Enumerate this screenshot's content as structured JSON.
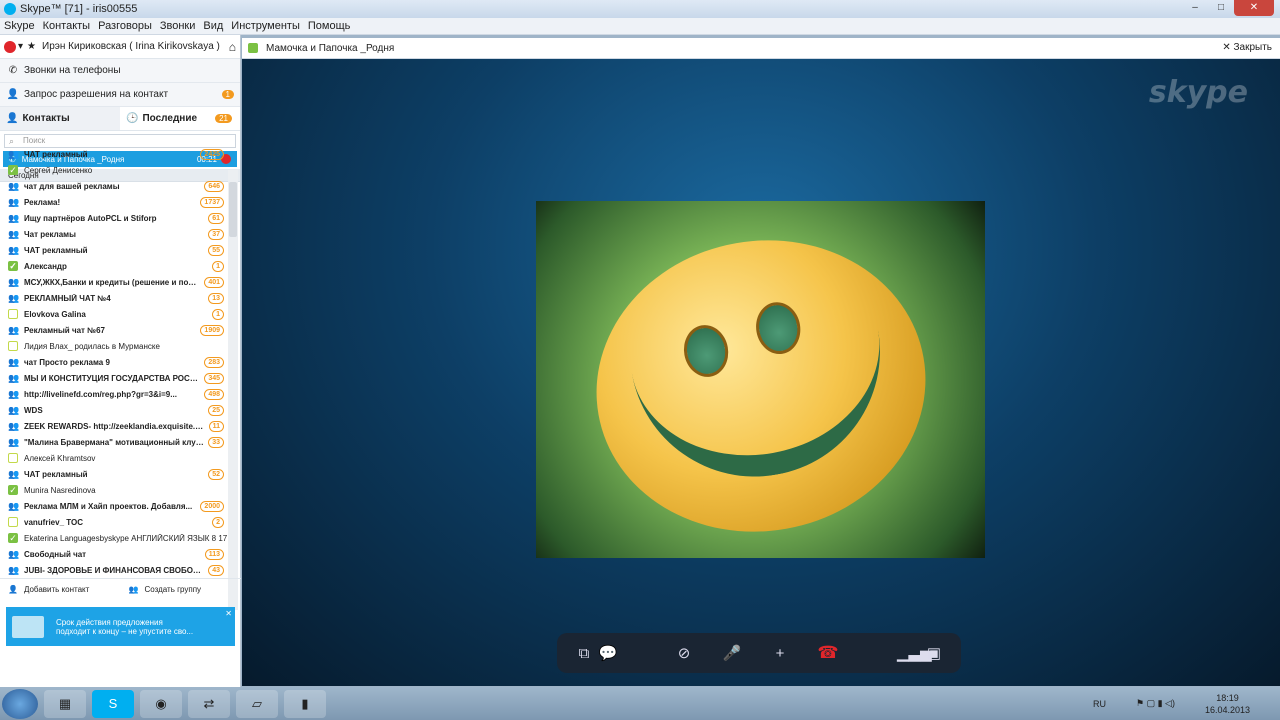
{
  "window": {
    "title": "Skype™ [71] - iris00555",
    "controls": [
      "–",
      "□",
      "✕"
    ]
  },
  "menu": [
    "Skype",
    "Контакты",
    "Разговоры",
    "Звонки",
    "Вид",
    "Инструменты",
    "Помощь"
  ],
  "profile": {
    "name": "Ирэн  Кириковская ( Irina Kirikovskaya )"
  },
  "phone_calls": {
    "label": "Звонки на телефоны"
  },
  "auth_request": {
    "label": "Запрос разрешения на контакт",
    "badge": "1"
  },
  "tabs": {
    "contacts": "Контакты",
    "recent": "Последние",
    "recent_badge": "21"
  },
  "search": {
    "placeholder": "Поиск"
  },
  "active_call": {
    "name": "Мамочка и Папочка _Родня",
    "time": "00:21"
  },
  "group_label": "Сегодня",
  "list": [
    {
      "name": "ЧАТ рекламный",
      "count": "2425",
      "type": "group",
      "bold": true
    },
    {
      "name": "Сергей Денисенко",
      "count": "",
      "type": "online",
      "bold": false
    },
    {
      "name": "чат для вашей рекламы",
      "count": "646",
      "type": "group",
      "bold": true
    },
    {
      "name": "Реклама!",
      "count": "1737",
      "type": "group",
      "bold": true
    },
    {
      "name": "Ищу партнёров AutoPCL и Stiforp",
      "count": "61",
      "type": "group",
      "bold": true
    },
    {
      "name": "Чат рекламы",
      "count": "37",
      "type": "group",
      "bold": true
    },
    {
      "name": "ЧАТ рекламный",
      "count": "55",
      "type": "group",
      "bold": true
    },
    {
      "name": "Александр",
      "count": "1",
      "type": "online",
      "bold": true
    },
    {
      "name": "МСУ,ЖКХ,Банки и кредиты (решение и пом...",
      "count": "401",
      "type": "group",
      "bold": true
    },
    {
      "name": "РЕКЛАМНЫЙ ЧАТ №4",
      "count": "13",
      "type": "group",
      "bold": true
    },
    {
      "name": "Elovkova  Galina",
      "count": "1",
      "type": "offline",
      "bold": true
    },
    {
      "name": "Рекламный чат №67",
      "count": "1909",
      "type": "group",
      "bold": true
    },
    {
      "name": "Лидия Влах_ родилась в Мурманске",
      "count": "",
      "type": "offline",
      "bold": false
    },
    {
      "name": "чат Просто реклама 9",
      "count": "283",
      "type": "group",
      "bold": true
    },
    {
      "name": "МЫ И КОНСТИТУЦИЯ ГОСУДАРСТВА РОССИ...",
      "count": "345",
      "type": "group",
      "bold": true
    },
    {
      "name": "http://livelinefd.com/reg.php?gr=3&i=9...",
      "count": "498",
      "type": "group",
      "bold": true
    },
    {
      "name": "WDS",
      "count": "25",
      "type": "group",
      "bold": true
    },
    {
      "name": "ZEEK REWARDS- http://zeeklandia.exquisite.c...",
      "count": "11",
      "type": "group",
      "bold": true
    },
    {
      "name": "\"Малина Бравермана\" мотивационный клуб...",
      "count": "33",
      "type": "group",
      "bold": true
    },
    {
      "name": "Алексей  Khramtsov",
      "count": "",
      "type": "offline",
      "bold": false
    },
    {
      "name": "ЧАТ рекламный",
      "count": "52",
      "type": "group",
      "bold": true
    },
    {
      "name": "Munira Nasredinova",
      "count": "",
      "type": "online",
      "bold": false
    },
    {
      "name": "Реклама МЛМ и Хайп проектов. Добавля...",
      "count": "2000",
      "type": "group",
      "bold": true
    },
    {
      "name": "vanufriev_ TOC",
      "count": "2",
      "type": "offline",
      "bold": true
    },
    {
      "name": "Ekaterina Languagesbyskype АНГЛИЙСКИЙ ЯЗЫК  8 17",
      "count": "",
      "type": "online",
      "bold": false
    },
    {
      "name": "Свободный чат",
      "count": "113",
      "type": "group",
      "bold": true
    },
    {
      "name": "JUBI- ЗДОРОВЬЕ И ФИНАНСОВАЯ СВОБОДА",
      "count": "43",
      "type": "group",
      "bold": true
    }
  ],
  "bottom": {
    "add_contact": "Добавить контакт",
    "create_group": "Создать группу"
  },
  "promo": {
    "line1": "Срок действия предложения",
    "line2": "подходит к концу – не упустите сво..."
  },
  "chat": {
    "title": "Мамочка и Папочка _Родня",
    "close": "Закрыть"
  },
  "video": {
    "logo": "skype"
  },
  "taskbar": {
    "lang": "RU",
    "time": "18:19",
    "date": "16.04.2013"
  }
}
